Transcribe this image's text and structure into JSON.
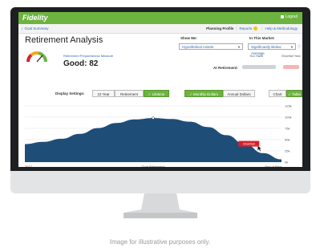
{
  "header": {
    "brand": "Fidelity",
    "logout": "Logout"
  },
  "subnav": {
    "back": "Goal Summary",
    "planning_profile": "Planning Profile",
    "reports": "Reports",
    "help": "Help & Methodology"
  },
  "page": {
    "title": "Retirement Analysis",
    "measure_label": "Retirement Preparedness Measure",
    "score": "Good: 82"
  },
  "show_me": {
    "label": "Show Me:",
    "value": "Hypothetical Assets"
  },
  "in_this_market": {
    "label": "In This Market:",
    "value": "Significantly Below Average"
  },
  "you_have": {
    "label": "You Have"
  },
  "shortfall_year": {
    "label": "Shortfall Year"
  },
  "at_retirement": {
    "label": "At Retirement:"
  },
  "settings": {
    "label": "Display Settings:",
    "range": [
      "10 Year",
      "Retirement",
      "Lifetime"
    ],
    "dollars": [
      "Monthly Dollars",
      "Annual Dollars"
    ],
    "view": [
      "Chart",
      "Table"
    ]
  },
  "chart_data": {
    "type": "area",
    "x_labels": [
      "2017",
      "Goal Retirement",
      "End of Plan"
    ],
    "y_ticks": [
      "125k",
      "100k",
      "75k",
      "50k",
      "25k",
      "0k"
    ],
    "ylim": [
      0,
      125000
    ],
    "values": [
      40000,
      45000,
      52000,
      63000,
      76000,
      87000,
      95000,
      98000,
      96000,
      90000,
      78000,
      60000,
      40000,
      20000,
      6000
    ],
    "marker_label": "Shortfall",
    "colors": {
      "area": "#1e4e78",
      "marker": "#d8202a"
    }
  },
  "caption": "Image for illustrative purposes only."
}
